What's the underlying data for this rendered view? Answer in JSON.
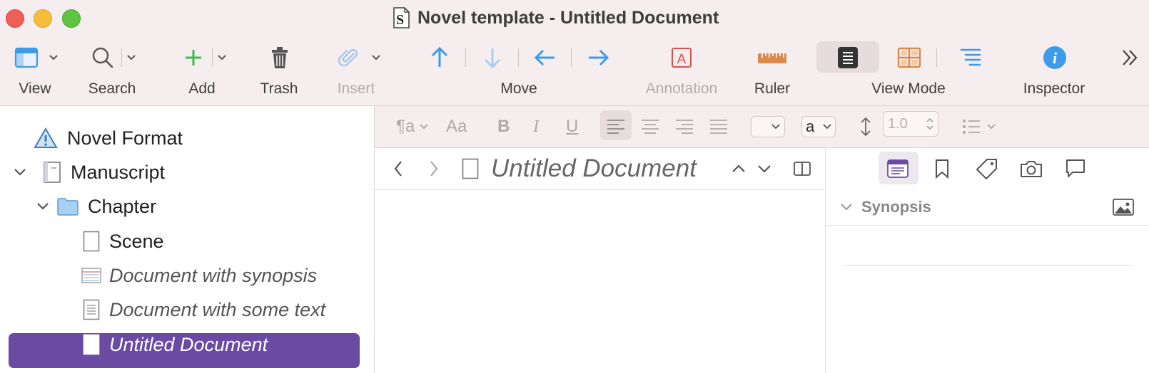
{
  "window": {
    "title": "Novel template - Untitled Document"
  },
  "toolbar": {
    "view": "View",
    "search": "Search",
    "add": "Add",
    "trash": "Trash",
    "insert": "Insert",
    "move": "Move",
    "annotation": "Annotation",
    "ruler": "Ruler",
    "view_mode": "View Mode",
    "inspector": "Inspector"
  },
  "binder": {
    "items": [
      {
        "label": "Novel Format"
      },
      {
        "label": "Manuscript"
      },
      {
        "label": "Chapter"
      },
      {
        "label": "Scene"
      },
      {
        "label": "Document with synopsis"
      },
      {
        "label": "Document with some text"
      },
      {
        "label": "Untitled Document"
      }
    ]
  },
  "format_bar": {
    "paragraph_style_glyph": "¶a",
    "fonts_glyph": "Aa",
    "bold": "B",
    "italic": "I",
    "underline": "U",
    "text_color_glyph": "a",
    "line_spacing": "1.0"
  },
  "editor": {
    "document_title": "Untitled Document"
  },
  "inspector": {
    "section": "Synopsis"
  },
  "icons": {
    "warning": "warning-icon",
    "accent": "#6b4aa3",
    "blue": "#3d9be9",
    "add_green": "#3fb950",
    "ruler_orange": "#d98a4a",
    "annotation_red": "#d9534f"
  }
}
